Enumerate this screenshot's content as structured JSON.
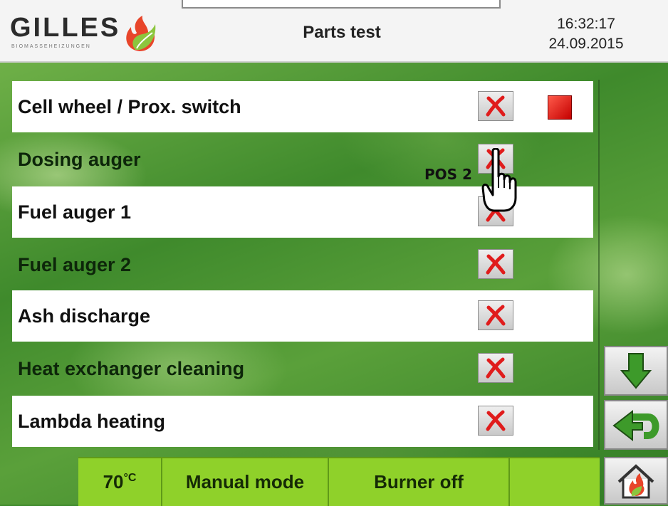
{
  "header": {
    "brand": "GILLES",
    "brand_sub": "BIOMASSEHEIZUNGEN",
    "title": "Parts test",
    "time": "16:32:17",
    "date": "24.09.2015"
  },
  "rows": [
    {
      "label": "Cell wheel / Prox. switch",
      "button_icon": "red-x-icon",
      "has_indicator": true
    },
    {
      "label": "Dosing auger",
      "button_icon": "red-x-icon"
    },
    {
      "label": "Fuel auger 1",
      "button_icon": "red-x-icon"
    },
    {
      "label": "Fuel auger 2",
      "button_icon": "red-x-icon"
    },
    {
      "label": "Ash discharge",
      "button_icon": "red-x-icon"
    },
    {
      "label": "Heat exchanger cleaning",
      "button_icon": "red-x-icon"
    },
    {
      "label": "Lambda heating",
      "button_icon": "red-x-icon"
    }
  ],
  "side_buttons": {
    "down_icon": "arrow-down-icon",
    "back_icon": "return-arrow-icon",
    "home_icon": "home-flame-icon"
  },
  "status": {
    "temp_value": "70",
    "temp_unit": "°C",
    "mode": "Manual mode",
    "burner": "Burner off",
    "empty": ""
  },
  "annotation": {
    "label": "POS 2",
    "icon": "hand-pointer-icon"
  },
  "colors": {
    "accent_green": "#8fd12a",
    "indicator_red": "#e01010",
    "x_red": "#e01c1c"
  }
}
